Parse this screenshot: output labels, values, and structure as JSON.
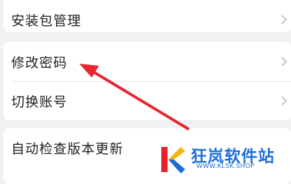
{
  "settings": {
    "items": [
      {
        "label": "安装包管理"
      },
      {
        "label": "修改密码"
      },
      {
        "label": "切换账号"
      },
      {
        "label": "自动检查版本更新"
      }
    ]
  },
  "watermark": {
    "title": "狂岚软件站",
    "url": "WWW.KLSK.SHOP",
    "accent": "#1c6fd8",
    "logo_colors": [
      "#e8212e",
      "#f6b40e",
      "#1c6fd8"
    ]
  },
  "annotation": {
    "arrow_color": "#e8242e",
    "points_to": "修改密码"
  }
}
